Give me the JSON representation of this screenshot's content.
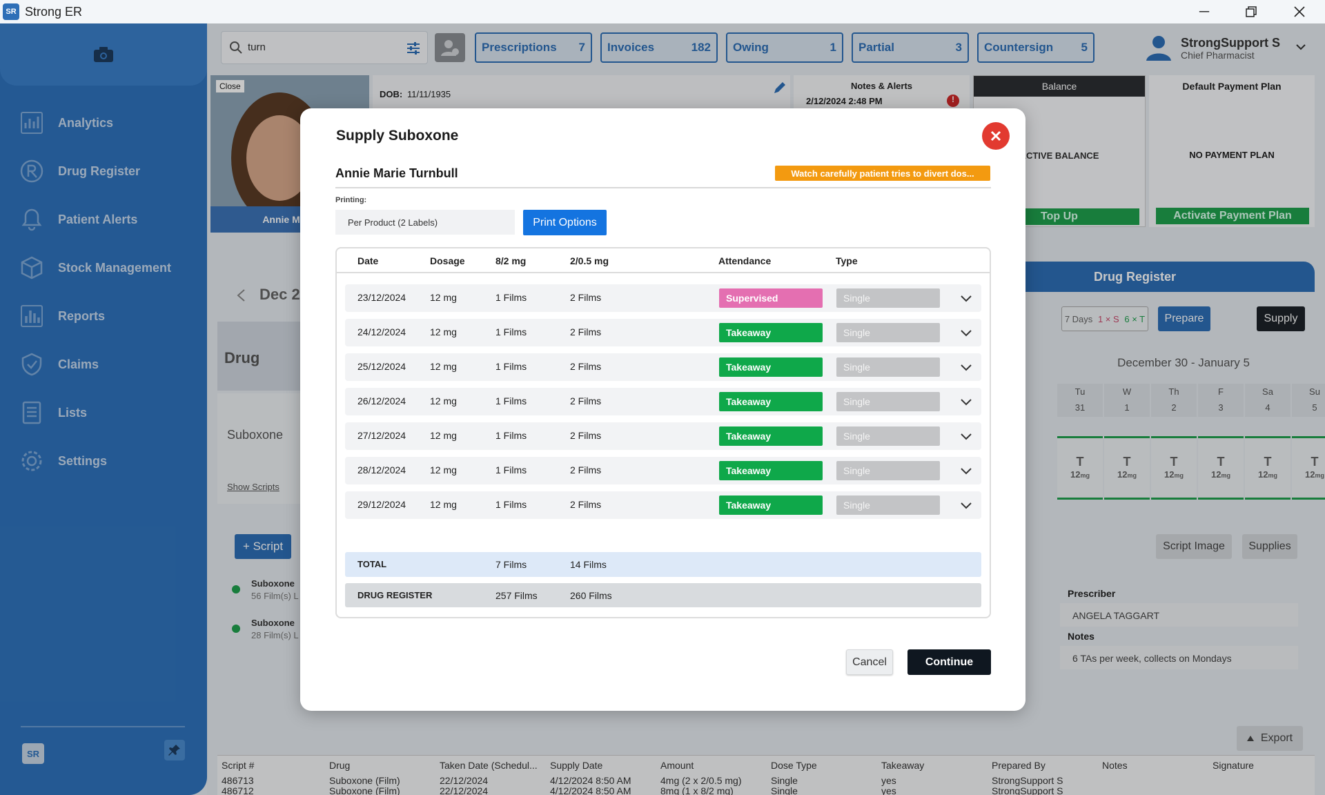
{
  "app": {
    "logo": "SR",
    "title": "Strong ER"
  },
  "sidebar": {
    "items": [
      {
        "label": "Analytics",
        "icon": "analytics-icon"
      },
      {
        "label": "Drug Register",
        "icon": "rx-icon"
      },
      {
        "label": "Patient Alerts",
        "icon": "bell-icon"
      },
      {
        "label": "Stock Management",
        "icon": "box-icon"
      },
      {
        "label": "Reports",
        "icon": "bar-chart-icon"
      },
      {
        "label": "Claims",
        "icon": "shield-check-icon"
      },
      {
        "label": "Lists",
        "icon": "list-icon"
      },
      {
        "label": "Settings",
        "icon": "gear-icon"
      }
    ],
    "logo": "SR"
  },
  "header": {
    "search_value": "turn",
    "buttons": [
      {
        "label": "Prescriptions",
        "count": "7"
      },
      {
        "label": "Invoices",
        "count": "182"
      },
      {
        "label": "Owing",
        "count": "1"
      },
      {
        "label": "Partial",
        "count": "3"
      },
      {
        "label": "Countersign",
        "count": "5"
      }
    ],
    "user_name": "StrongSupport S",
    "user_role": "Chief Pharmacist"
  },
  "patient_panel": {
    "close_label": "Close",
    "name": "Annie Marie",
    "dob_label": "DOB:",
    "dob": "11/11/1935",
    "notes_title": "Notes & Alerts",
    "notes_date": "2/12/2024 2:48 PM",
    "balance_title": "Balance",
    "balance_status": "ACTIVE BALANCE",
    "top_up": "Top Up",
    "payment_title": "Default Payment Plan",
    "payment_status": "NO PAYMENT PLAN",
    "activate_plan": "Activate Payment Plan"
  },
  "background": {
    "month_label": "Dec 2",
    "drug_header": "Drug",
    "drug_name": "Suboxone",
    "show_scripts": "Show Scripts",
    "add_script": "+ Script",
    "scripts": [
      {
        "name": "Suboxone",
        "detail": "56 Film(s) L"
      },
      {
        "name": "Suboxone",
        "detail": "28 Film(s) L"
      }
    ],
    "drug_register_title": "Drug Register",
    "days_pill": {
      "days": "7 Days",
      "s": "1 × S",
      "t": "6 × T"
    },
    "prepare": "Prepare",
    "supply": "Supply",
    "week_range": "December 30 - January 5",
    "week_days": [
      "Tu",
      "W",
      "Th",
      "F",
      "Sa",
      "Su"
    ],
    "week_dates": [
      "31",
      "1",
      "2",
      "3",
      "4",
      "5"
    ],
    "day_cells": [
      {
        "letter": "T",
        "dose": "12",
        "unit": "mg"
      },
      {
        "letter": "T",
        "dose": "12",
        "unit": "mg"
      },
      {
        "letter": "T",
        "dose": "12",
        "unit": "mg"
      },
      {
        "letter": "T",
        "dose": "12",
        "unit": "mg"
      },
      {
        "letter": "T",
        "dose": "12",
        "unit": "mg"
      },
      {
        "letter": "T",
        "dose": "12",
        "unit": "mg"
      }
    ],
    "script_image": "Script Image",
    "supplies": "Supplies",
    "prescriber_label": "Prescriber",
    "prescriber": "ANGELA TAGGART",
    "notes_label": "Notes",
    "notes": "6 TAs per week, collects on Mondays",
    "export": "Export",
    "bottom_headers": [
      "Script #",
      "Drug",
      "Taken Date (Schedul...",
      "Supply Date",
      "Amount",
      "Dose Type",
      "Takeaway",
      "Prepared By",
      "Notes",
      "Signature"
    ],
    "bottom_rows": [
      [
        "486713",
        "Suboxone (Film)",
        "22/12/2024",
        "4/12/2024 8:50 AM",
        "4mg (2 x 2/0.5 mg)",
        "Single",
        "yes",
        "StrongSupport S",
        "",
        ""
      ],
      [
        "486712",
        "Suboxone (Film)",
        "22/12/2024",
        "4/12/2024 8:50 AM",
        "8mg (1 x 8/2 mg)",
        "Single",
        "yes",
        "StrongSupport S",
        "",
        ""
      ]
    ]
  },
  "modal": {
    "title": "Supply Suboxone",
    "patient_name": "Annie Marie Turnbull",
    "alert": "Watch carefully patient tries to divert dos...",
    "printing_label": "Printing:",
    "printing_value": "Per Product (2 Labels)",
    "print_options": "Print Options",
    "columns": [
      "Date",
      "Dosage",
      "8/2 mg",
      "2/0.5 mg",
      "Attendance",
      "Type"
    ],
    "rows": [
      {
        "date": "23/12/2024",
        "dosage": "12 mg",
        "a": "1 Films",
        "b": "2 Films",
        "attendance": "Supervised",
        "type": "Single"
      },
      {
        "date": "24/12/2024",
        "dosage": "12 mg",
        "a": "1 Films",
        "b": "2 Films",
        "attendance": "Takeaway",
        "type": "Single"
      },
      {
        "date": "25/12/2024",
        "dosage": "12 mg",
        "a": "1 Films",
        "b": "2 Films",
        "attendance": "Takeaway",
        "type": "Single"
      },
      {
        "date": "26/12/2024",
        "dosage": "12 mg",
        "a": "1 Films",
        "b": "2 Films",
        "attendance": "Takeaway",
        "type": "Single"
      },
      {
        "date": "27/12/2024",
        "dosage": "12 mg",
        "a": "1 Films",
        "b": "2 Films",
        "attendance": "Takeaway",
        "type": "Single"
      },
      {
        "date": "28/12/2024",
        "dosage": "12 mg",
        "a": "1 Films",
        "b": "2 Films",
        "attendance": "Takeaway",
        "type": "Single"
      },
      {
        "date": "29/12/2024",
        "dosage": "12 mg",
        "a": "1 Films",
        "b": "2 Films",
        "attendance": "Takeaway",
        "type": "Single"
      }
    ],
    "total": {
      "label": "TOTAL",
      "a": "7 Films",
      "b": "14 Films"
    },
    "register": {
      "label": "DRUG REGISTER",
      "a": "257 Films",
      "b": "260 Films"
    },
    "cancel": "Cancel",
    "continue": "Continue"
  },
  "colors": {
    "sidebar": "#2f73bd",
    "accent": "#1474e0",
    "supervised": "#e46fb1",
    "takeaway": "#0fa84a",
    "alert": "#f39a10",
    "close": "#e23a30"
  }
}
